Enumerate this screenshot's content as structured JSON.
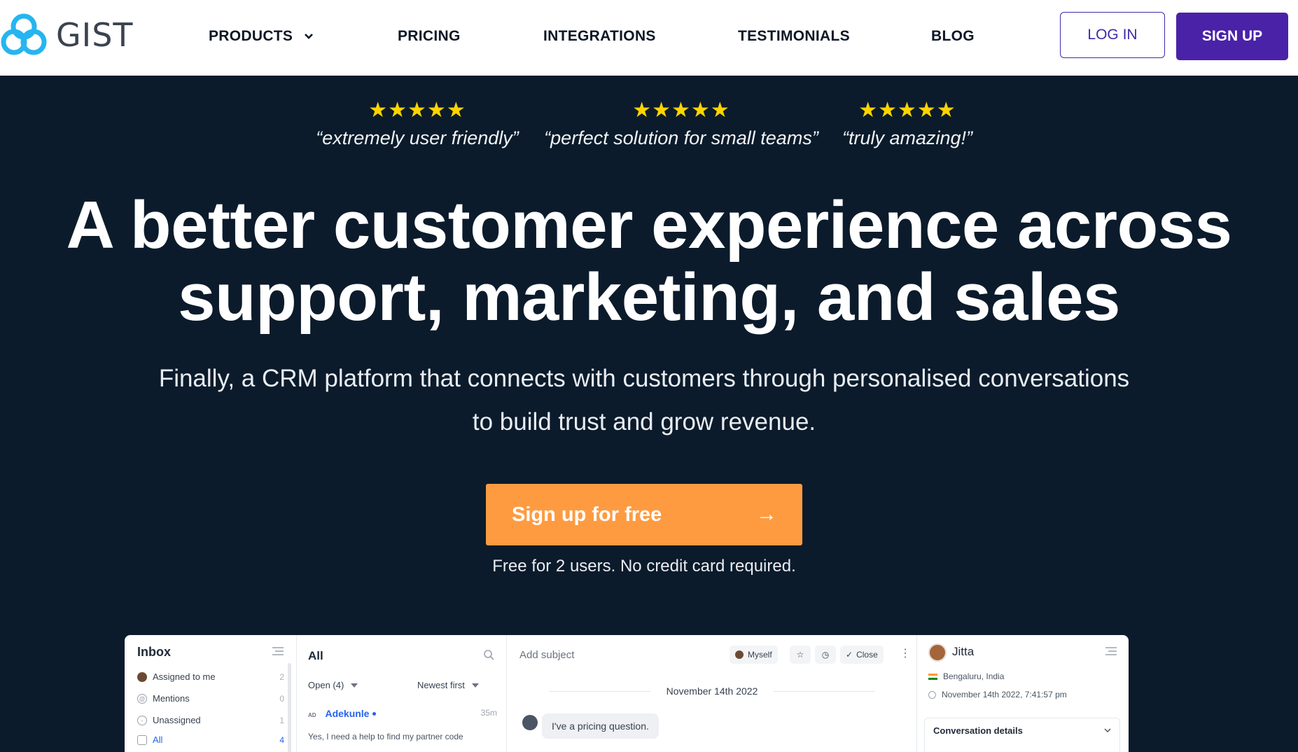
{
  "nav": {
    "logo_text": "GIST",
    "links": [
      {
        "label": "PRODUCTS"
      },
      {
        "label": "PRICING"
      },
      {
        "label": "INTEGRATIONS"
      },
      {
        "label": "TESTIMONIALS"
      },
      {
        "label": "BLOG"
      }
    ],
    "login_label": "LOG IN",
    "signup_label": "SIGN UP"
  },
  "reviews": [
    {
      "stars": "★★★★★",
      "rating": 5,
      "quote": "“extremely user friendly”"
    },
    {
      "stars": "★★★★★",
      "rating": 5,
      "quote": "“perfect solution for small teams”"
    },
    {
      "stars": "★★★★★",
      "rating": 5,
      "quote": "“truly amazing!”"
    }
  ],
  "hero": {
    "title_line1": "A better customer experience across",
    "title_line2": "support, marketing, and sales",
    "subtitle_line1": "Finally, a CRM platform that connects with customers through personalised conversations",
    "subtitle_line2": "to build trust and grow revenue.",
    "cta_label": "Sign up for free",
    "cta_arrow": "→",
    "cta_note": "Free for 2 users. No credit card required."
  },
  "app": {
    "inbox": {
      "title": "Inbox",
      "items": [
        {
          "label": "Assigned to me",
          "count": "2"
        },
        {
          "label": "Mentions",
          "count": "0"
        },
        {
          "label": "Unassigned",
          "count": "1"
        },
        {
          "label": "All",
          "count": "4"
        }
      ]
    },
    "list": {
      "title": "All",
      "filter": "Open (4)",
      "sort": "Newest first",
      "conversation": {
        "initials": "AD",
        "name": "Adekunle",
        "time": "35m",
        "snippet": "Yes, I need a help to find my partner code"
      }
    },
    "conversation": {
      "subject_placeholder": "Add subject",
      "assignee": "Myself",
      "close_label": "Close",
      "date": "November 14th 2022",
      "message": "I've a pricing question."
    },
    "user": {
      "name": "Jitta",
      "location": "Bengaluru, India",
      "local_time": "November 14th 2022, 7:41:57 pm",
      "details_title": "Conversation details"
    }
  },
  "colors": {
    "hero_bg": "#0b1b2b",
    "brand_purple": "#4a22a8",
    "cta_orange": "#fe9b41",
    "star_yellow": "#ffd400",
    "logo_blue": "#26b5f0"
  }
}
